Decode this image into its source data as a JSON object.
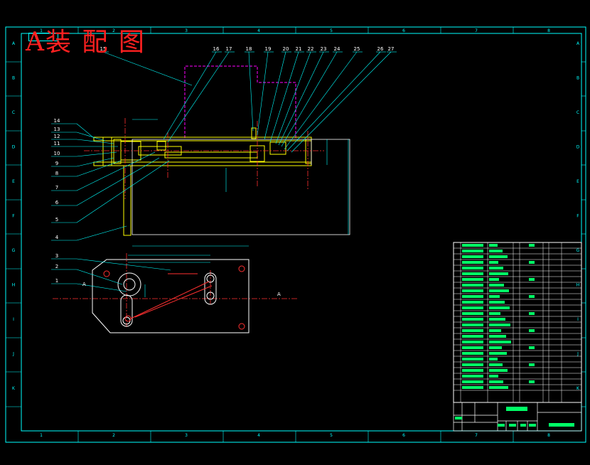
{
  "drawing": {
    "title": "A装 配 图",
    "top_code": "",
    "border_zone_numbers": [
      "1",
      "2",
      "3",
      "4",
      "5",
      "6",
      "7",
      "8"
    ],
    "border_zone_letters": [
      "A",
      "B",
      "C",
      "D",
      "E",
      "F",
      "G",
      "H",
      "I",
      "J",
      "K"
    ],
    "top_callouts": [
      "15",
      "16",
      "17",
      "18",
      "19",
      "20",
      "21",
      "22",
      "23",
      "24",
      "25",
      "26",
      "27"
    ],
    "left_callouts": [
      "14",
      "13",
      "12",
      "11",
      "10",
      "9",
      "8",
      "7",
      "6",
      "5",
      "4",
      "3",
      "2",
      "1"
    ],
    "view_marker": "A"
  },
  "colors": {
    "background": "#000000",
    "frame": "#00ffff",
    "part": "#ffff00",
    "hidden_outline": "#ff00ff",
    "center_line": "#ff3030",
    "leader": "#00ffff",
    "text": "#ffffff",
    "title": "#ff2020"
  }
}
